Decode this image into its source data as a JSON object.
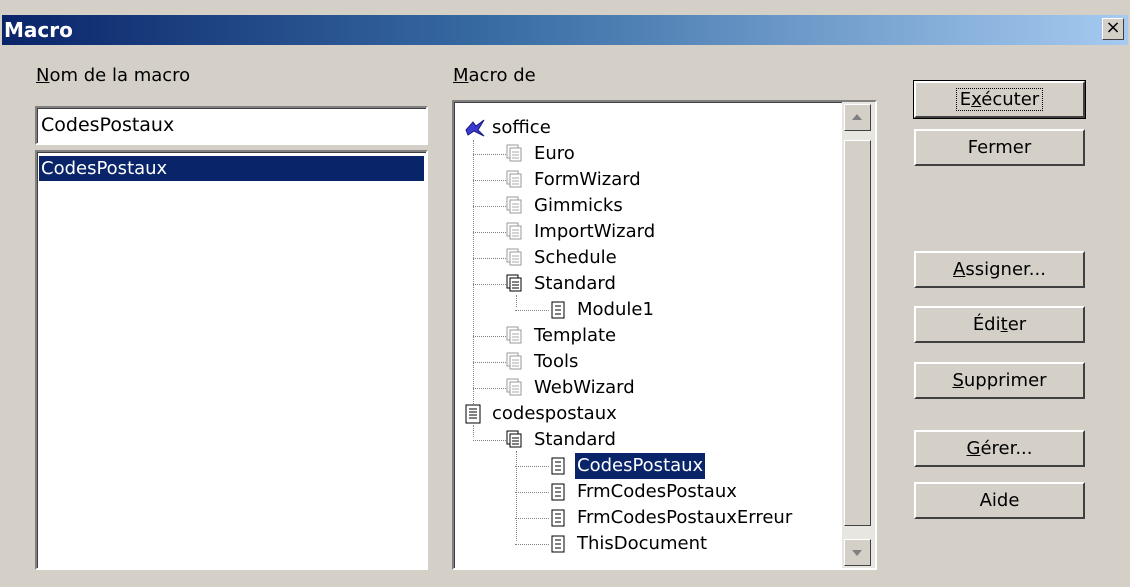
{
  "window": {
    "title": "Macro",
    "close_glyph": "×"
  },
  "left": {
    "name_label": "Nom de la macro",
    "name_value": "CodesPostaux",
    "list_items": [
      "CodesPostaux"
    ]
  },
  "tree": {
    "label": "Macro de",
    "items": [
      {
        "text": "soffice",
        "icon": "soffice-app-icon",
        "level": 0
      },
      {
        "text": "Euro",
        "icon": "library-icon",
        "level": 1
      },
      {
        "text": "FormWizard",
        "icon": "library-icon",
        "level": 1
      },
      {
        "text": "Gimmicks",
        "icon": "library-icon",
        "level": 1
      },
      {
        "text": "ImportWizard",
        "icon": "library-icon",
        "level": 1
      },
      {
        "text": "Schedule",
        "icon": "library-icon",
        "level": 1
      },
      {
        "text": "Standard",
        "icon": "library-open-icon",
        "level": 1
      },
      {
        "text": "Module1",
        "icon": "module-icon",
        "level": 2
      },
      {
        "text": "Template",
        "icon": "library-icon",
        "level": 1
      },
      {
        "text": "Tools",
        "icon": "library-icon",
        "level": 1
      },
      {
        "text": "WebWizard",
        "icon": "library-icon",
        "level": 1
      },
      {
        "text": "codespostaux",
        "icon": "document-icon",
        "level": 0
      },
      {
        "text": "Standard",
        "icon": "library-open-icon",
        "level": 1
      },
      {
        "text": "CodesPostaux",
        "icon": "module-icon",
        "level": 2,
        "selected": true
      },
      {
        "text": "FrmCodesPostaux",
        "icon": "module-icon",
        "level": 2
      },
      {
        "text": "FrmCodesPostauxErreur",
        "icon": "module-icon",
        "level": 2
      },
      {
        "text": "ThisDocument",
        "icon": "module-icon",
        "level": 2
      }
    ]
  },
  "buttons": {
    "run": "Exécuter",
    "close": "Fermer",
    "assign": "Assigner...",
    "edit": "Éditer",
    "delete": "Supprimer",
    "manage": "Gérer...",
    "help": "Aide"
  },
  "colors": {
    "selection": "#0a246a",
    "face": "#d4d0c8"
  }
}
